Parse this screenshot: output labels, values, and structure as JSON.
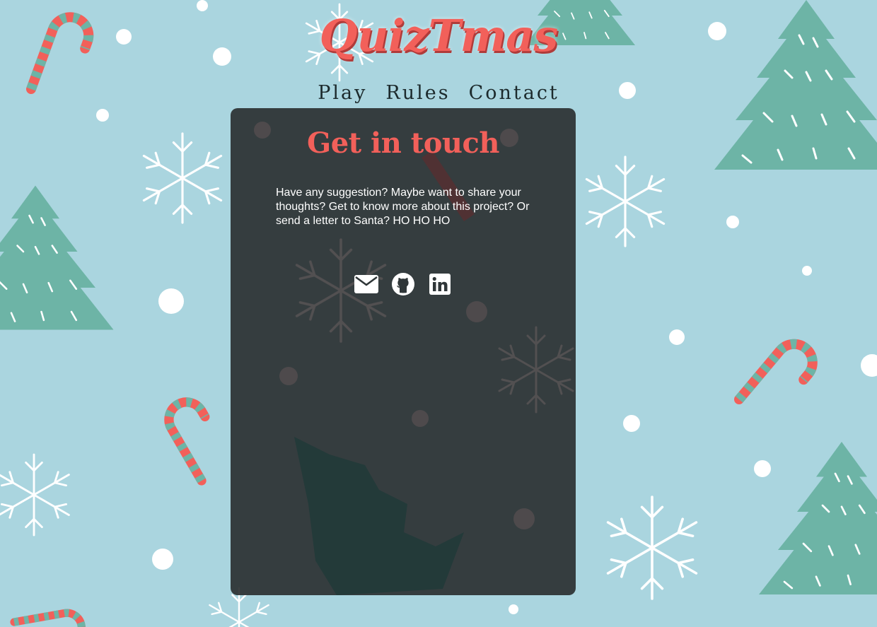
{
  "site": {
    "title": "QuizTmas"
  },
  "nav": {
    "items": [
      "Play",
      "Rules",
      "Contact"
    ]
  },
  "contact": {
    "title": "Get in touch",
    "message": "Have any suggestion? Maybe want to share your thoughts? Get to know more about this project? Or send a letter to Santa? HO HO HO",
    "socials": [
      "envelope-icon",
      "github-icon",
      "linkedin-icon"
    ]
  },
  "colors": {
    "background": "#aad5df",
    "accent": "#f2605a",
    "tree": "#6db4a6",
    "card": "#2f3638",
    "text": "#ffffff"
  }
}
